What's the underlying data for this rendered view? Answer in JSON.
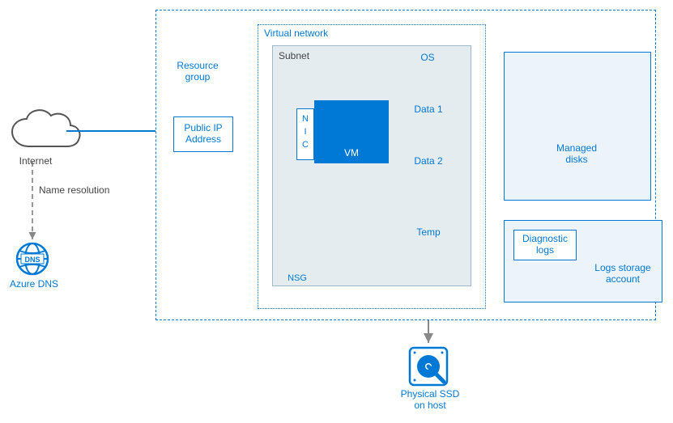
{
  "internet_label": "Internet",
  "dns_label": "Azure DNS",
  "dns_arrow_label": "Name resolution",
  "rg_label": "Resource\ngroup",
  "pip_label": "Public IP\nAddress",
  "vnet_label": "Virtual network",
  "subnet_label": "Subnet",
  "nic_label": "N\nI\nC",
  "vm_label": "VM",
  "nsg_label": "NSG",
  "disk_os_label": "OS",
  "disk_data1_label": "Data 1",
  "disk_data2_label": "Data 2",
  "disk_temp_label": "Temp",
  "managed_disks_label": "Managed\ndisks",
  "diag_label": "Diagnostic\nlogs",
  "log_storage_label": "Logs storage\naccount",
  "ssd_label": "Physical SSD\non host",
  "colors": {
    "azure_blue": "#0079d6",
    "panel_grey": "#e4ecf0",
    "panel_blue": "#ecf3fb"
  }
}
